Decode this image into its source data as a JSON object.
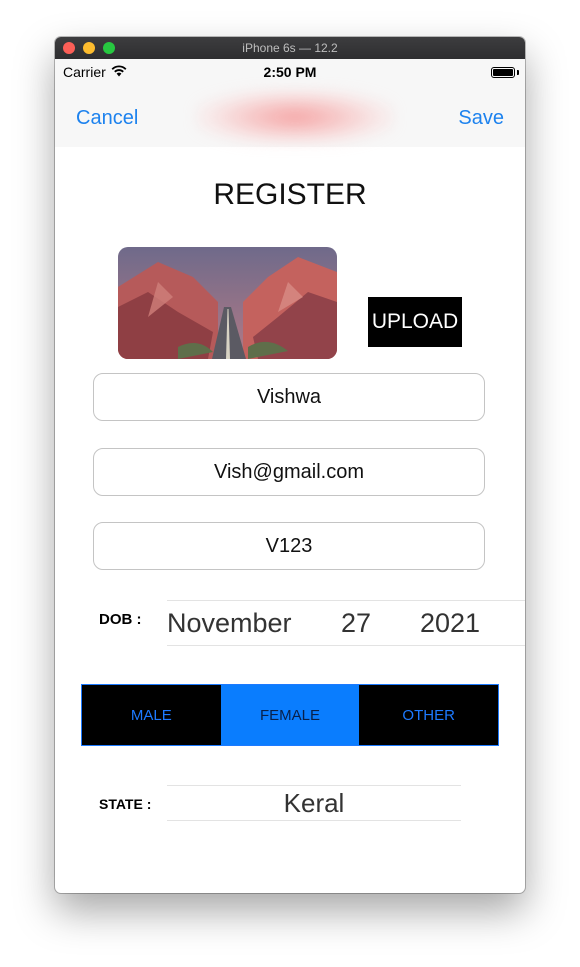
{
  "window": {
    "title": "iPhone 6s — 12.2"
  },
  "status_bar": {
    "carrier": "Carrier",
    "time": "2:50 PM"
  },
  "nav": {
    "cancel_label": "Cancel",
    "save_label": "Save"
  },
  "screen": {
    "title": "REGISTER",
    "upload_label": "UPLOAD",
    "fields": {
      "name": "Vishwa",
      "email": "Vish@gmail.com",
      "password": "V123"
    },
    "dob": {
      "label": "DOB :",
      "month": "November",
      "day": "27",
      "year": "2021"
    },
    "gender": {
      "options": [
        "MALE",
        "FEMALE",
        "OTHER"
      ],
      "selected": "FEMALE"
    },
    "state": {
      "label": "STATE :",
      "value": "Keral"
    }
  },
  "icons": [
    "wifi-icon",
    "battery-icon",
    "landscape-photo"
  ],
  "colors": {
    "accent": "#1d82ee",
    "segment_selected": "#0a7dfe",
    "segment_bg": "#000000",
    "upload_bg": "#000000"
  }
}
